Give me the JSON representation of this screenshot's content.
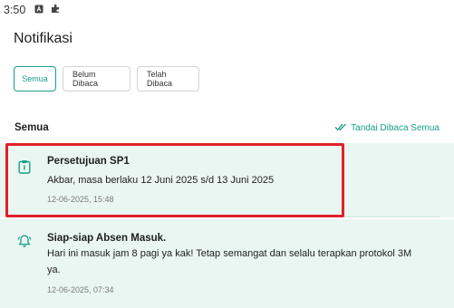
{
  "status_bar": {
    "time": "3:50",
    "icons": [
      "notification-a-icon",
      "puzzle-icon"
    ]
  },
  "header": {
    "title": "Notifikasi"
  },
  "filter_tabs": [
    {
      "label": "Semua",
      "active": true
    },
    {
      "label": "Belum Dibaca",
      "active": false
    },
    {
      "label": "Telah Dibaca",
      "active": false
    }
  ],
  "section": {
    "title": "Semua",
    "mark_all_label": "Tandai Dibaca Semua"
  },
  "notifications": [
    {
      "icon": "clipboard-icon",
      "title": "Persetujuan SP1",
      "body": "Akbar, masa berlaku 12 Juni 2025 s/d 13 Juni 2025",
      "time": "12-06-2025, 15:48",
      "highlighted": true
    },
    {
      "icon": "bell-icon",
      "title": "Siap-siap Absen Masuk.",
      "body": "Hari ini masuk jam 8 pagi ya kak! Tetap semangat dan selalu terapkan protokol 3M ya.",
      "time": "12-06-2025, 07:34",
      "highlighted": false
    }
  ],
  "colors": {
    "accent": "#17a086",
    "card_bg": "#e9f6f2",
    "highlight": "#e0202a"
  }
}
